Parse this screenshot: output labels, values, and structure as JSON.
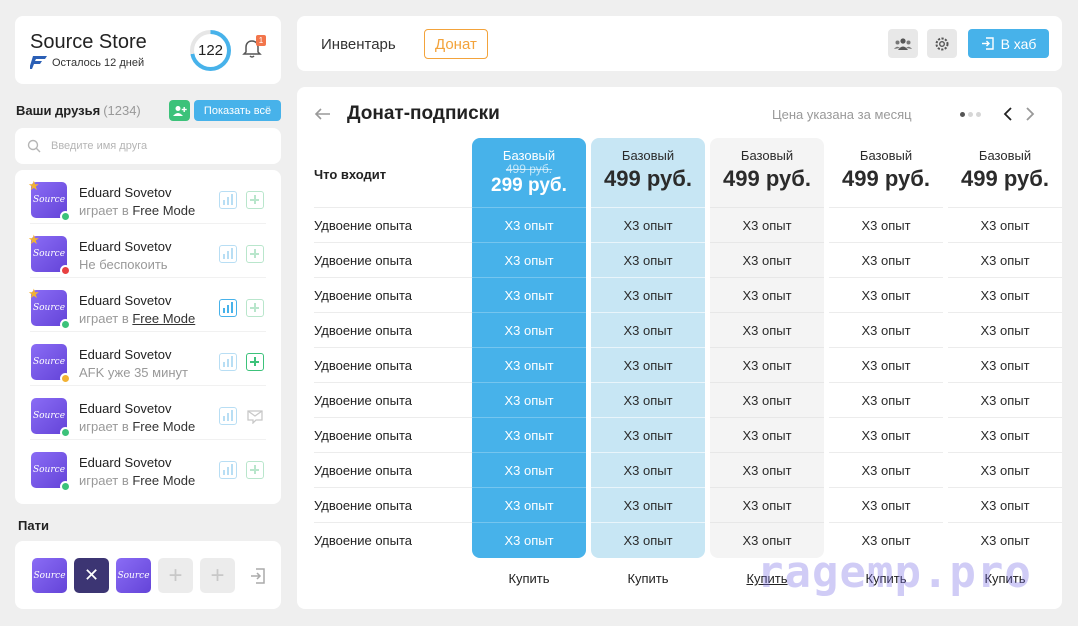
{
  "store": {
    "title": "Source Store",
    "subscription_left": "Осталось 12 дней",
    "level": "122",
    "level_progress": 0.72,
    "notifications_count": "1"
  },
  "friends": {
    "title": "Ваши друзья",
    "count": "(1234)",
    "show_all_label": "Показать всё",
    "search_placeholder": "Введите имя друга",
    "avatar_text": "Source",
    "items": [
      {
        "name": "Eduard Sovetov",
        "status_prefix": "играет в ",
        "status_game": "Free Mode",
        "starred": true,
        "presence": "online",
        "presence_color": "#3cc27a",
        "action2": "add"
      },
      {
        "name": "Eduard Sovetov",
        "status_prefix": "Не беспокоить",
        "status_game": "",
        "starred": true,
        "presence": "busy",
        "presence_color": "#e84040",
        "action2": "add"
      },
      {
        "name": "Eduard Sovetov",
        "status_prefix": "играет в ",
        "status_game": "Free Mode",
        "starred": true,
        "presence": "online",
        "presence_color": "#3cc27a",
        "action2": "add"
      },
      {
        "name": "Eduard Sovetov",
        "status_prefix": "AFK уже 35 минут",
        "status_game": "",
        "starred": false,
        "presence": "away",
        "presence_color": "#f2b233",
        "action2": "add"
      },
      {
        "name": "Eduard Sovetov",
        "status_prefix": "играет в ",
        "status_game": "Free Mode",
        "starred": false,
        "presence": "online",
        "presence_color": "#3cc27a",
        "action2": "message"
      },
      {
        "name": "Eduard Sovetov",
        "status_prefix": "играет в ",
        "status_game": "Free Mode",
        "starred": false,
        "presence": "online",
        "presence_color": "#3cc27a",
        "action2": "add"
      }
    ]
  },
  "party": {
    "title": "Пати",
    "slots": [
      "filled",
      "kick",
      "filled",
      "empty",
      "empty"
    ]
  },
  "nav": {
    "tab_inventory": "Инвентарь",
    "tab_donate": "Донат",
    "hub_label": "В хаб",
    "active_tab": "Донат"
  },
  "panel": {
    "title": "Донат-подписки",
    "price_note": "Цена указана за месяц",
    "row_header": "Что входит",
    "row_labels": [
      "Удвоение опыта",
      "Удвоение опыта",
      "Удвоение опыта",
      "Удвоение опыта",
      "Удвоение опыта",
      "Удвоение опыта",
      "Удвоение опыта",
      "Удвоение опыта",
      "Удвоение опыта",
      "Удвоение опыта"
    ],
    "plans": [
      {
        "name": "Базовый",
        "old_price": "499 руб.",
        "price": "299 руб.",
        "cells": [
          "X3 опыт",
          "X3 опыт",
          "X3 опыт",
          "X3 опыт",
          "X3 опыт",
          "X3 опыт",
          "X3 опыт",
          "X3 опыт",
          "X3 опыт",
          "X3 опыт"
        ],
        "buy": "Купить"
      },
      {
        "name": "Базовый",
        "old_price": "",
        "price": "499 руб.",
        "cells": [
          "X3 опыт",
          "X3 опыт",
          "X3 опыт",
          "X3 опыт",
          "X3 опыт",
          "X3 опыт",
          "X3 опыт",
          "X3 опыт",
          "X3 опыт",
          "X3 опыт"
        ],
        "buy": "Купить"
      },
      {
        "name": "Базовый",
        "old_price": "",
        "price": "499 руб.",
        "cells": [
          "X3 опыт",
          "X3 опыт",
          "X3 опыт",
          "X3 опыт",
          "X3 опыт",
          "X3 опыт",
          "X3 опыт",
          "X3 опыт",
          "X3 опыт",
          "X3 опыт"
        ],
        "buy": "Купить"
      },
      {
        "name": "Базовый",
        "old_price": "",
        "price": "499 руб.",
        "cells": [
          "X3 опыт",
          "X3 опыт",
          "X3 опыт",
          "X3 опыт",
          "X3 опыт",
          "X3 опыт",
          "X3 опыт",
          "X3 опыт",
          "X3 опыт",
          "X3 опыт"
        ],
        "buy": "Купить"
      },
      {
        "name": "Базовый",
        "old_price": "",
        "price": "499 руб.",
        "cells": [
          "X3 опыт",
          "X3 опыт",
          "X3 опыт",
          "X3 опыт",
          "X3 опыт",
          "X3 опыт",
          "X3 опыт",
          "X3 опыт",
          "X3 опыт",
          "X3 опыт"
        ],
        "buy": "Купить"
      }
    ],
    "page_dots": 3,
    "active_dot": 0
  },
  "watermark": "ragemp.pro",
  "colors": {
    "accent": "#47b2ea",
    "donate": "#f3a33b",
    "green": "#3cc27a",
    "badge": "#f2754b"
  }
}
